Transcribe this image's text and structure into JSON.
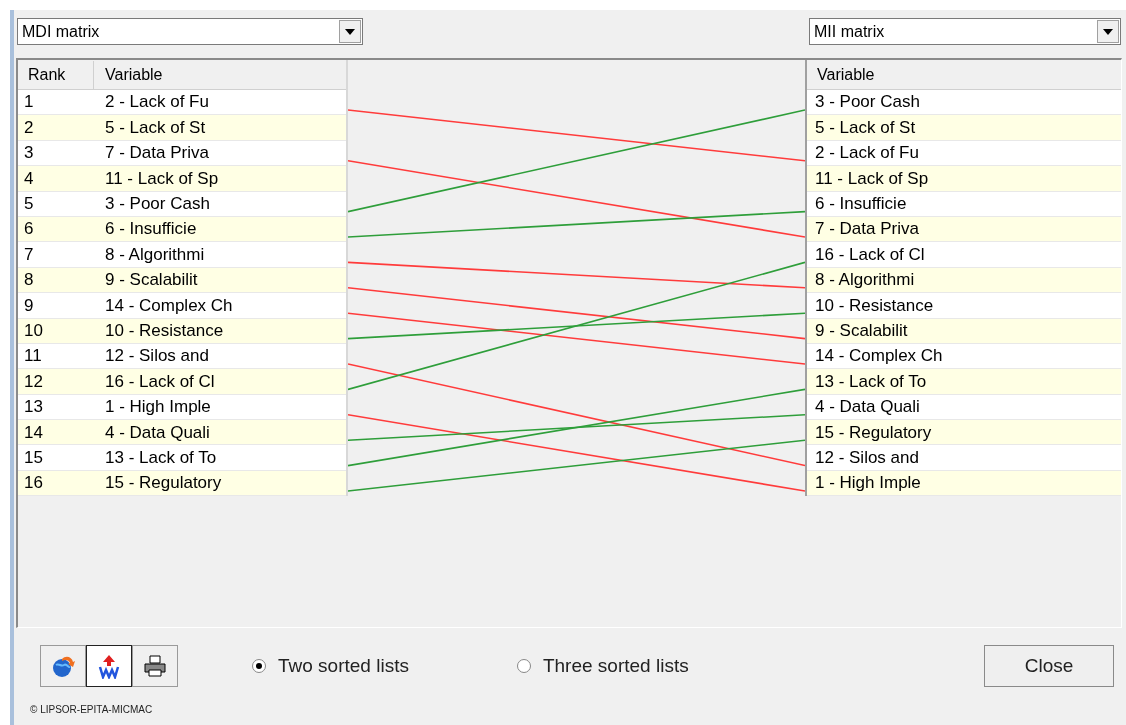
{
  "left_combo": {
    "value": "MDI matrix"
  },
  "right_combo": {
    "value": "MII matrix"
  },
  "left_table": {
    "columns": [
      "Rank",
      "Variable"
    ],
    "rows": [
      {
        "rank": "1",
        "variable": "2 - Lack of Fu"
      },
      {
        "rank": "2",
        "variable": "5 - Lack of St"
      },
      {
        "rank": "3",
        "variable": "7 - Data Priva"
      },
      {
        "rank": "4",
        "variable": "11 - Lack of Sp"
      },
      {
        "rank": "5",
        "variable": "3 - Poor Cash"
      },
      {
        "rank": "6",
        "variable": "6 - Insufficie"
      },
      {
        "rank": "7",
        "variable": "8 - Algorithmi"
      },
      {
        "rank": "8",
        "variable": "9 - Scalabilit"
      },
      {
        "rank": "9",
        "variable": "14 - Complex Ch"
      },
      {
        "rank": "10",
        "variable": "10 - Resistance"
      },
      {
        "rank": "11",
        "variable": "12 - Silos and"
      },
      {
        "rank": "12",
        "variable": "16 - Lack of Cl"
      },
      {
        "rank": "13",
        "variable": "1 - High Imple"
      },
      {
        "rank": "14",
        "variable": "4 - Data Quali"
      },
      {
        "rank": "15",
        "variable": "13 - Lack of To"
      },
      {
        "rank": "16",
        "variable": "15 - Regulatory"
      }
    ]
  },
  "right_table": {
    "columns": [
      "Variable"
    ],
    "rows": [
      "3 - Poor Cash",
      "5 - Lack of St",
      "2 - Lack of Fu",
      "11 - Lack of Sp",
      "6 - Insufficie",
      "7 - Data Priva",
      "16 - Lack of Cl",
      "8 - Algorithmi",
      "10 - Resistance",
      "9 - Scalabilit",
      "14 - Complex Ch",
      "13 - Lack of To",
      "4 - Data Quali",
      "15 - Regulatory",
      "12 - Silos and",
      "1 - High Imple"
    ]
  },
  "tools": [
    {
      "kind": "globe",
      "pressed": false
    },
    {
      "kind": "word",
      "pressed": true
    },
    {
      "kind": "print",
      "pressed": false
    }
  ],
  "options": [
    {
      "label": "Two sorted lists",
      "selected": true
    },
    {
      "label": "Three sorted lists",
      "selected": false
    }
  ],
  "close_button": "Close",
  "copyright": "© LIPSOR-EPITA-MICMAC"
}
